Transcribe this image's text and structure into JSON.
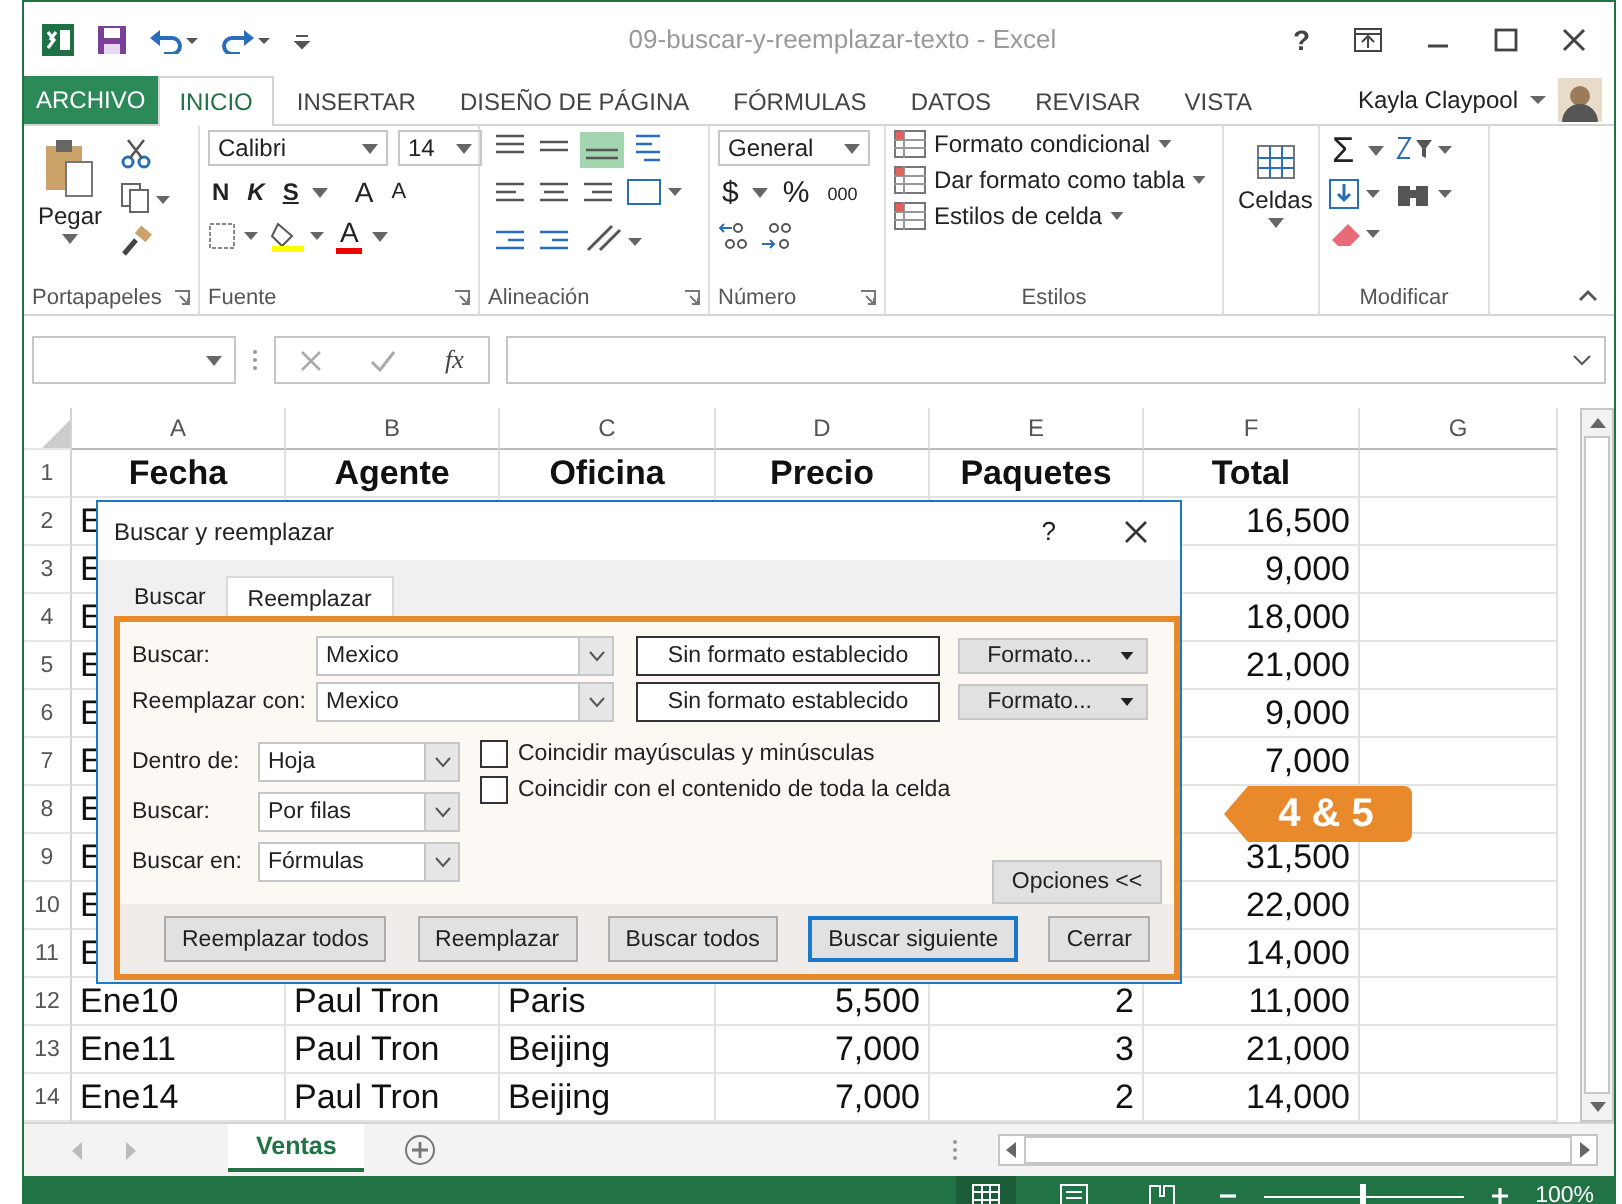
{
  "window": {
    "title": "09-buscar-y-reemplazar-texto - Excel",
    "help": "?"
  },
  "ribbon_tabs": [
    {
      "label": "ARCHIVO",
      "kind": "file",
      "selected": false
    },
    {
      "label": "INICIO",
      "kind": "tab",
      "selected": true
    },
    {
      "label": "INSERTAR",
      "kind": "tab",
      "selected": false
    },
    {
      "label": "DISEÑO DE PÁGINA",
      "kind": "tab",
      "selected": false
    },
    {
      "label": "FÓRMULAS",
      "kind": "tab",
      "selected": false
    },
    {
      "label": "DATOS",
      "kind": "tab",
      "selected": false
    },
    {
      "label": "REVISAR",
      "kind": "tab",
      "selected": false
    },
    {
      "label": "VISTA",
      "kind": "tab",
      "selected": false
    }
  ],
  "user": {
    "name": "Kayla Claypool"
  },
  "ribbon": {
    "clipboard": {
      "paste": "Pegar",
      "label": "Portapapeles"
    },
    "font": {
      "name": "Calibri",
      "size": "14",
      "bold": "N",
      "italic": "K",
      "underline": "S",
      "grow": "A",
      "shrink": "A",
      "font_color_button": "A",
      "label": "Fuente"
    },
    "alignment": {
      "label": "Alineación"
    },
    "number": {
      "format": "General",
      "currency": "$",
      "percent": "%",
      "thousands": "000",
      "label": "Número"
    },
    "styles": {
      "items": [
        "Formato condicional",
        "Dar formato como tabla",
        "Estilos de celda"
      ],
      "label": "Estilos"
    },
    "cells": {
      "button": "Celdas"
    },
    "editing": {
      "sum": "Σ",
      "label": "Modificar"
    }
  },
  "formula_bar": {
    "fx": "fx"
  },
  "sheet": {
    "columns": [
      {
        "letter": "A",
        "kind": "text"
      },
      {
        "letter": "B",
        "kind": "text"
      },
      {
        "letter": "C",
        "kind": "text"
      },
      {
        "letter": "D",
        "kind": "number"
      },
      {
        "letter": "E",
        "kind": "number"
      },
      {
        "letter": "F",
        "kind": "number"
      },
      {
        "letter": "G",
        "kind": "text"
      }
    ],
    "rows": [
      {
        "number": "1",
        "kind": "header",
        "cells": {
          "A": "Fecha",
          "B": "Agente",
          "C": "Oficina",
          "D": "Precio",
          "E": "Paquetes",
          "F": "Total"
        }
      },
      {
        "number": "2",
        "kind": "data",
        "cells": {
          "A": "E",
          "F": "16,500"
        }
      },
      {
        "number": "3",
        "kind": "data",
        "cells": {
          "A": "E",
          "F": "9,000"
        }
      },
      {
        "number": "4",
        "kind": "data",
        "cells": {
          "A": "E",
          "F": "18,000"
        }
      },
      {
        "number": "5",
        "kind": "data",
        "cells": {
          "A": "E",
          "F": "21,000"
        }
      },
      {
        "number": "6",
        "kind": "data",
        "cells": {
          "A": "E",
          "F": "9,000"
        }
      },
      {
        "number": "7",
        "kind": "data",
        "cells": {
          "A": "E",
          "F": "7,000"
        }
      },
      {
        "number": "8",
        "kind": "data",
        "cells": {
          "A": "E"
        }
      },
      {
        "number": "9",
        "kind": "data",
        "cells": {
          "A": "E",
          "F": "31,500"
        }
      },
      {
        "number": "10",
        "kind": "data",
        "cells": {
          "A": "E",
          "F": "22,000"
        }
      },
      {
        "number": "11",
        "kind": "data",
        "cells": {
          "A": "E",
          "F": "14,000"
        }
      },
      {
        "number": "12",
        "kind": "data",
        "cells": {
          "A": "Ene10",
          "B": "Paul Tron",
          "C": "Paris",
          "D": "5,500",
          "E": "2",
          "F": "11,000"
        }
      },
      {
        "number": "13",
        "kind": "data",
        "cells": {
          "A": "Ene11",
          "B": "Paul Tron",
          "C": "Beijing",
          "D": "7,000",
          "E": "3",
          "F": "21,000"
        }
      },
      {
        "number": "14",
        "kind": "data",
        "cells": {
          "A": "Ene14",
          "B": "Paul Tron",
          "C": "Beijing",
          "D": "7,000",
          "E": "2",
          "F": "14,000"
        }
      }
    ]
  },
  "sheet_tabs": [
    {
      "label": "Ventas",
      "selected": true
    }
  ],
  "status_bar": {
    "zoom": "100%",
    "zoom_slider": {
      "level": 0.5
    }
  },
  "dialog": {
    "title": "Buscar y reemplazar",
    "help": "?",
    "tabs": [
      {
        "label": "Buscar",
        "selected": false
      },
      {
        "label": "Reemplazar",
        "selected": true
      }
    ],
    "fields": [
      {
        "label": "Buscar:",
        "value": "Mexico",
        "format": "Sin formato establecido",
        "format_button": "Formato..."
      },
      {
        "label": "Reemplazar con:",
        "value": "Mexico",
        "format": "Sin formato establecido",
        "format_button": "Formato..."
      }
    ],
    "options": [
      {
        "label": "Dentro de:",
        "value": "Hoja"
      },
      {
        "label": "Buscar:",
        "value": "Por filas"
      },
      {
        "label": "Buscar en:",
        "value": "Fórmulas"
      }
    ],
    "checkboxes": [
      {
        "label": "Coincidir mayúsculas y minúsculas",
        "checked": false
      },
      {
        "label": "Coincidir con el contenido de toda la celda",
        "checked": false
      }
    ],
    "options_button": "Opciones <<",
    "buttons": [
      {
        "label": "Reemplazar todos",
        "selected": false
      },
      {
        "label": "Reemplazar",
        "selected": false
      },
      {
        "label": "Buscar todos",
        "selected": false
      },
      {
        "label": "Buscar siguiente",
        "selected": true
      },
      {
        "label": "Cerrar",
        "selected": false
      }
    ]
  },
  "callout": {
    "text": "4 & 5"
  }
}
